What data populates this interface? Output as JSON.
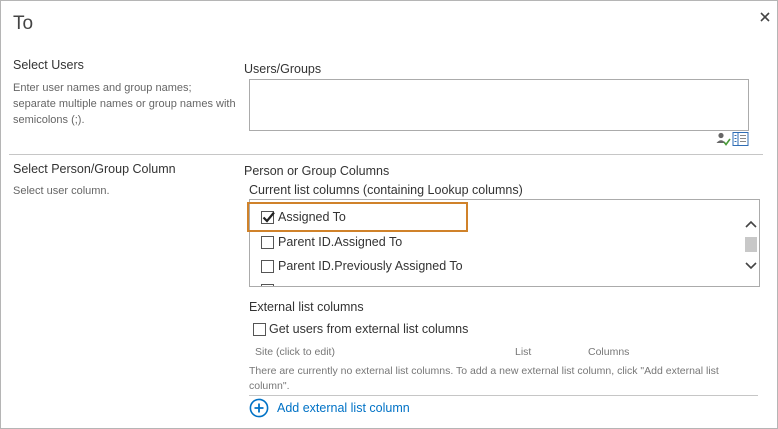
{
  "dialog": {
    "title": "To"
  },
  "select_users": {
    "heading": "Select Users",
    "description": "Enter user names and group names; separate multiple names or group names with semicolons (;).",
    "field_label": "Users/Groups",
    "field_value": ""
  },
  "person_group": {
    "heading": "Select Person/Group Column",
    "description": "Select user column.",
    "columns_label": "Person or Group Columns",
    "current_label": "Current list columns (containing Lookup columns)",
    "items": [
      {
        "label": "Assigned To",
        "checked": true
      },
      {
        "label": "Parent ID.Assigned To",
        "checked": false
      },
      {
        "label": "Parent ID.Previously Assigned To",
        "checked": false
      }
    ]
  },
  "external": {
    "label": "External list columns",
    "checkbox_label": "Get users from external list columns",
    "checked": false,
    "headers": [
      "Site (click to edit)",
      "List",
      "Columns"
    ],
    "note": "There are currently no external list columns. To add a new external list column, click \"Add external list column\".",
    "add_link": "Add external list column"
  },
  "colors": {
    "highlight": "#d0822a",
    "link": "#0072c6"
  },
  "icons": {
    "close": "close-icon",
    "check_names": "check-names-icon",
    "browse": "address-book-icon",
    "add": "plus-circle-icon"
  }
}
